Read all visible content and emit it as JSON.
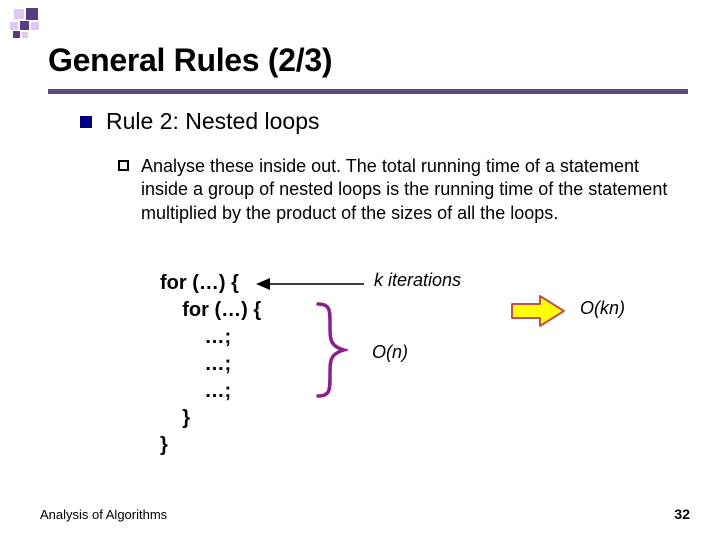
{
  "title": "General Rules (2/3)",
  "b1": {
    "text": "Rule 2: Nested loops"
  },
  "b2": {
    "text": "Analyse these inside out. The total running time of a statement inside a group of nested loops is the running time of the statement multiplied by the product of the sizes of all the loops."
  },
  "code": "for (…) {\n    for (…) {\n        …;\n        …;\n        …;\n    }\n}",
  "annot": {
    "k": "k iterations",
    "on": "O(n)",
    "okn": "O(kn)"
  },
  "footer": {
    "left": "Analysis of Algorithms",
    "right": "32"
  },
  "colors": {
    "accent": "#604a7b",
    "navy": "#000080",
    "brace": "#8b1f8b",
    "arrow_line": "#000",
    "big_arrow_stroke": "#c0504d",
    "big_arrow_fill": "#ffff00"
  }
}
